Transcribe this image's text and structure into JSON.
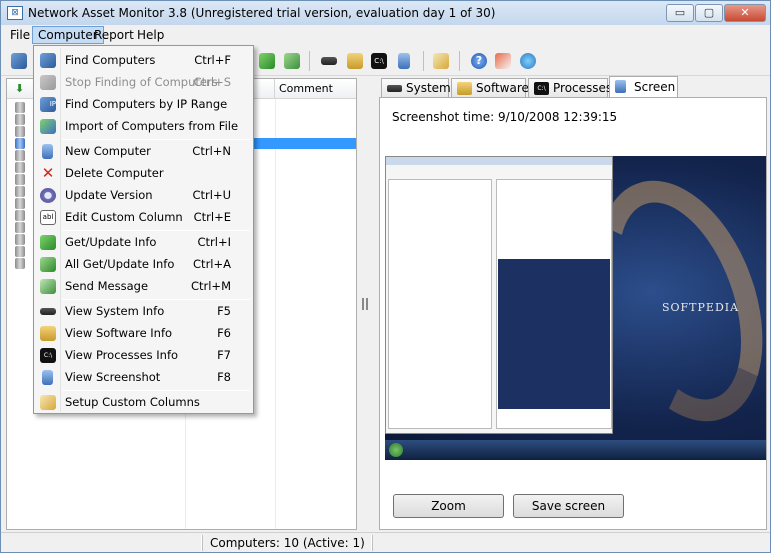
{
  "window": {
    "title": "Network Asset Monitor 3.8 (Unregistered trial version, evaluation day 1 of 30)",
    "controls": {
      "minimize": "▭",
      "maximize": "▢",
      "close": "✕"
    }
  },
  "menubar": {
    "items": [
      "File",
      "Computer",
      "Report",
      "Help"
    ],
    "active": "Computer"
  },
  "left_panel": {
    "columns": [
      "Comment"
    ],
    "selected_row_text": "..."
  },
  "tabs": [
    {
      "label": "System",
      "icon": "memory-chip-icon"
    },
    {
      "label": "Software",
      "icon": "software-window-icon"
    },
    {
      "label": "Processes",
      "icon": "console-icon"
    },
    {
      "label": "Screen",
      "icon": "monitor-icon",
      "active": true
    }
  ],
  "screen": {
    "screenshot_time": "Screenshot time: 9/10/2008 12:39:15",
    "desktop_logo": "SOFTPEDIA",
    "zoom_button": "Zoom",
    "save_button": "Save screen"
  },
  "statusbar": {
    "text": "Computers: 10 (Active: 1)"
  },
  "computer_menu": {
    "items": [
      {
        "label": "Find Computers",
        "shortcut": "Ctrl+F",
        "icon": "find-computers-icon",
        "enabled": true
      },
      {
        "label": "Stop Finding of Computers",
        "shortcut": "Ctrl+S",
        "icon": "stop-finding-icon",
        "enabled": false
      },
      {
        "label": "Find Computers by IP Range",
        "shortcut": "",
        "icon": "ip-range-icon",
        "enabled": true
      },
      {
        "label": "Import of Computers from File",
        "shortcut": "",
        "icon": "import-icon",
        "enabled": true
      },
      {
        "label": "New Computer",
        "shortcut": "Ctrl+N",
        "icon": "new-computer-icon",
        "enabled": true
      },
      {
        "label": "Delete Computer",
        "shortcut": "",
        "icon": "delete-icon",
        "enabled": true
      },
      {
        "label": "Update Version",
        "shortcut": "Ctrl+U",
        "icon": "update-gear-icon",
        "enabled": true
      },
      {
        "label": "Edit Custom Column",
        "shortcut": "Ctrl+E",
        "icon": "text-field-icon",
        "enabled": true
      },
      {
        "label": "Get/Update Info",
        "shortcut": "Ctrl+I",
        "icon": "get-info-icon",
        "enabled": true
      },
      {
        "label": "All Get/Update Info",
        "shortcut": "Ctrl+A",
        "icon": "all-get-info-icon",
        "enabled": true
      },
      {
        "label": "Send Message",
        "shortcut": "Ctrl+M",
        "icon": "send-message-icon",
        "enabled": true
      },
      {
        "label": "View System Info",
        "shortcut": "F5",
        "icon": "memory-chip-icon",
        "enabled": true
      },
      {
        "label": "View Software Info",
        "shortcut": "F6",
        "icon": "software-window-icon",
        "enabled": true
      },
      {
        "label": "View Processes Info",
        "shortcut": "F7",
        "icon": "console-icon",
        "enabled": true
      },
      {
        "label": "View Screenshot",
        "shortcut": "F8",
        "icon": "monitor-icon",
        "enabled": true
      },
      {
        "label": "Setup Custom Columns",
        "shortcut": "",
        "icon": "setup-columns-icon",
        "enabled": true
      }
    ]
  },
  "colors": {
    "accent_selection": "#3399ff",
    "menu_highlight": "#c5dcf5",
    "title_gradient_top": "#dbe8f6",
    "close_button": "#c74a32"
  }
}
